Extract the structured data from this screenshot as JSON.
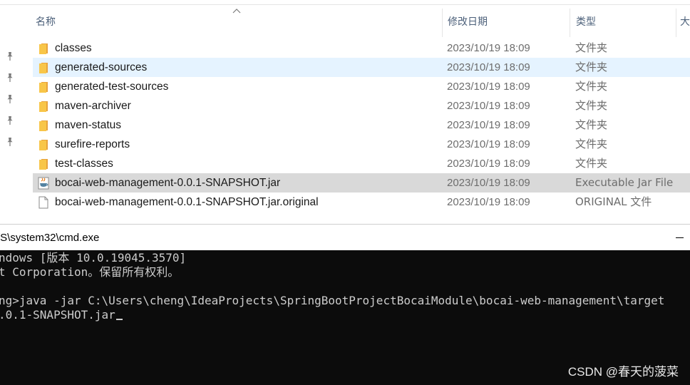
{
  "explorer": {
    "columns": {
      "name": "名称",
      "date": "修改日期",
      "type": "类型",
      "size": "大"
    },
    "files": [
      {
        "icon": "folder-icon",
        "name": "classes",
        "date": "2023/10/19 18:09",
        "type": "文件夹",
        "state": "normal"
      },
      {
        "icon": "folder-icon",
        "name": "generated-sources",
        "date": "2023/10/19 18:09",
        "type": "文件夹",
        "state": "hover"
      },
      {
        "icon": "folder-icon",
        "name": "generated-test-sources",
        "date": "2023/10/19 18:09",
        "type": "文件夹",
        "state": "normal"
      },
      {
        "icon": "folder-icon",
        "name": "maven-archiver",
        "date": "2023/10/19 18:09",
        "type": "文件夹",
        "state": "normal"
      },
      {
        "icon": "folder-icon",
        "name": "maven-status",
        "date": "2023/10/19 18:09",
        "type": "文件夹",
        "state": "normal"
      },
      {
        "icon": "folder-icon",
        "name": "surefire-reports",
        "date": "2023/10/19 18:09",
        "type": "文件夹",
        "state": "normal"
      },
      {
        "icon": "folder-icon",
        "name": "test-classes",
        "date": "2023/10/19 18:09",
        "type": "文件夹",
        "state": "normal"
      },
      {
        "icon": "java-jar-icon",
        "name": "bocai-web-management-0.0.1-SNAPSHOT.jar",
        "date": "2023/10/19 18:09",
        "type": "Executable Jar File",
        "state": "selected"
      },
      {
        "icon": "file-icon",
        "name": "bocai-web-management-0.0.1-SNAPSHOT.jar.original",
        "date": "2023/10/19 18:09",
        "type": "ORIGINAL 文件",
        "state": "normal"
      }
    ],
    "colors": {
      "hover_bg": "#e5f3ff",
      "selected_bg": "#d9d9d9",
      "folder": "#f8c649"
    }
  },
  "cmd": {
    "title": "/S\\system32\\cmd.exe",
    "lines": [
      "ndows [版本 10.0.19045.3570]",
      "t Corporation。保留所有权利。",
      "",
      "ng>java -jar C:\\Users\\cheng\\IdeaProjects\\SpringBootProjectBocaiModule\\bocai-web-management\\target",
      ".0.1-SNAPSHOT.jar"
    ],
    "watermark": "CSDN @春天的菠菜"
  }
}
